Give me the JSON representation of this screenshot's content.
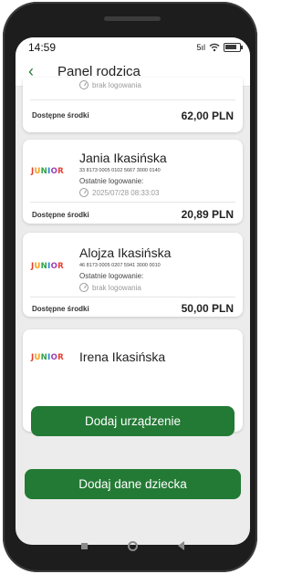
{
  "status": {
    "time": "14:59",
    "signal": "5ıl"
  },
  "header": {
    "back_icon": "‹",
    "title": "Panel rodzica"
  },
  "logo_text": [
    "J",
    "U",
    "N",
    "I",
    "O",
    "R"
  ],
  "cards": {
    "first": {
      "last_login_value": "brak logowania",
      "funds_label": "Dostępne środki",
      "funds_value": "62,00 PLN"
    },
    "jania": {
      "name": "Jania Ikasińska",
      "account": "33 8173 0005 0102 5667 3000 0140",
      "last_login_label": "Ostatnie logowanie:",
      "last_login_value": "2025/07/28 08:33:03",
      "funds_label": "Dostępne środki",
      "funds_value": "20,89 PLN"
    },
    "alojza": {
      "name": "Alojza Ikasińska",
      "account": "46 8173 0005 0207 5941 3000 0010",
      "last_login_label": "Ostatnie logowanie:",
      "last_login_value": "brak logowania",
      "funds_label": "Dostępne środki",
      "funds_value": "50,00 PLN"
    },
    "irena": {
      "name": "Irena Ikasińska",
      "button_label": "Dodaj urządzenie"
    }
  },
  "add_child_button": "Dodaj dane dziecka"
}
